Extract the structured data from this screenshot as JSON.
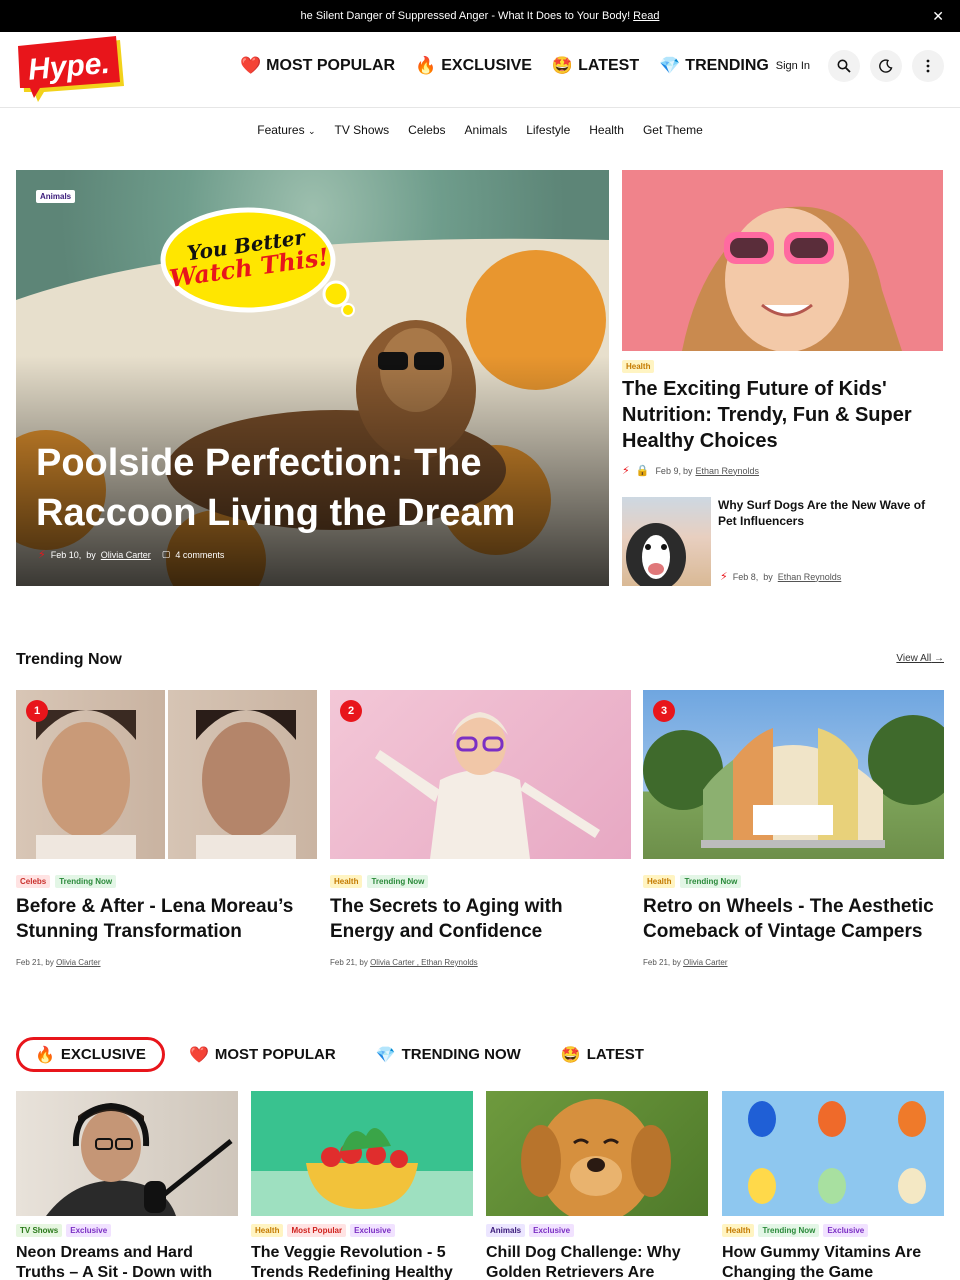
{
  "announcement": {
    "text": "he Silent Danger of Suppressed Anger - What It Does to Your Body!",
    "link": "Read",
    "close_icon": "close-icon"
  },
  "brand": {
    "logo_text": "Hype.",
    "accent": "#e8151b"
  },
  "main_nav": [
    {
      "emoji": "❤️",
      "label": "MOST POPULAR"
    },
    {
      "emoji": "🔥",
      "label": "EXCLUSIVE"
    },
    {
      "emoji": "🤩",
      "label": "LATEST"
    },
    {
      "emoji": "💎",
      "label": "TRENDING"
    }
  ],
  "header_actions": {
    "sign_in": "Sign In",
    "icons": [
      "search-icon",
      "moon-icon",
      "more-vertical-icon"
    ]
  },
  "sub_nav": [
    {
      "label": "Features",
      "has_dropdown": true
    },
    {
      "label": "TV Shows"
    },
    {
      "label": "Celebs"
    },
    {
      "label": "Animals"
    },
    {
      "label": "Lifestyle"
    },
    {
      "label": "Health"
    },
    {
      "label": "Get Theme"
    }
  ],
  "hero": {
    "badge": "Animals",
    "bubble_line1": "You Better",
    "bubble_line2": "Watch This!",
    "title": "Poolside Perfection: The Raccoon Living the Dream",
    "date": "Feb 10,",
    "by": "by",
    "author": "Olivia Carter",
    "comments": "4 comments"
  },
  "side_feature": {
    "badge": "Health",
    "title": "The Exciting Future of Kids' Nutrition: Trendy, Fun & Super Healthy Choices",
    "date": "Feb 9,",
    "by": "by",
    "author": "Ethan Reynolds"
  },
  "side_small": {
    "title": "Why Surf Dogs Are the New Wave of Pet Influencers",
    "date": "Feb 8,",
    "by": "by",
    "author": "Ethan Reynolds"
  },
  "trending": {
    "title": "Trending Now",
    "view_all": "View All",
    "items": [
      {
        "num": "1",
        "badges": [
          "Celebs",
          "Trending Now"
        ],
        "title": "Before & After - Lena Moreau’s Stunning Transformation",
        "date": "Feb 21,",
        "by": "by",
        "authors": "Olivia Carter"
      },
      {
        "num": "2",
        "badges": [
          "Health",
          "Trending Now"
        ],
        "title": "The Secrets to Aging with Energy and Confidence",
        "date": "Feb 21,",
        "by": "by",
        "authors": "Olivia Carter , Ethan Reynolds"
      },
      {
        "num": "3",
        "badges": [
          "Health",
          "Trending Now"
        ],
        "title": "Retro on Wheels - The Aesthetic Comeback of Vintage Campers",
        "date": "Feb 21,",
        "by": "by",
        "authors": "Olivia Carter"
      }
    ]
  },
  "tabs": [
    {
      "emoji": "🔥",
      "label": "EXCLUSIVE",
      "active": true
    },
    {
      "emoji": "❤️",
      "label": "MOST POPULAR"
    },
    {
      "emoji": "💎",
      "label": "TRENDING NOW"
    },
    {
      "emoji": "🤩",
      "label": "LATEST"
    }
  ],
  "grid": [
    {
      "badges": [
        "TV Shows",
        "Exclusive"
      ],
      "title": "Neon Dreams and Hard Truths – A Sit - Down with"
    },
    {
      "badges": [
        "Health",
        "Most Popular",
        "Exclusive"
      ],
      "title": "The Veggie Revolution - 5 Trends Redefining Healthy"
    },
    {
      "badges": [
        "Animals",
        "Exclusive"
      ],
      "title": "Chill Dog Challenge: Why Golden Retrievers Are"
    },
    {
      "badges": [
        "Health",
        "Trending Now",
        "Exclusive"
      ],
      "title": "How Gummy Vitamins Are Changing the Game"
    }
  ]
}
